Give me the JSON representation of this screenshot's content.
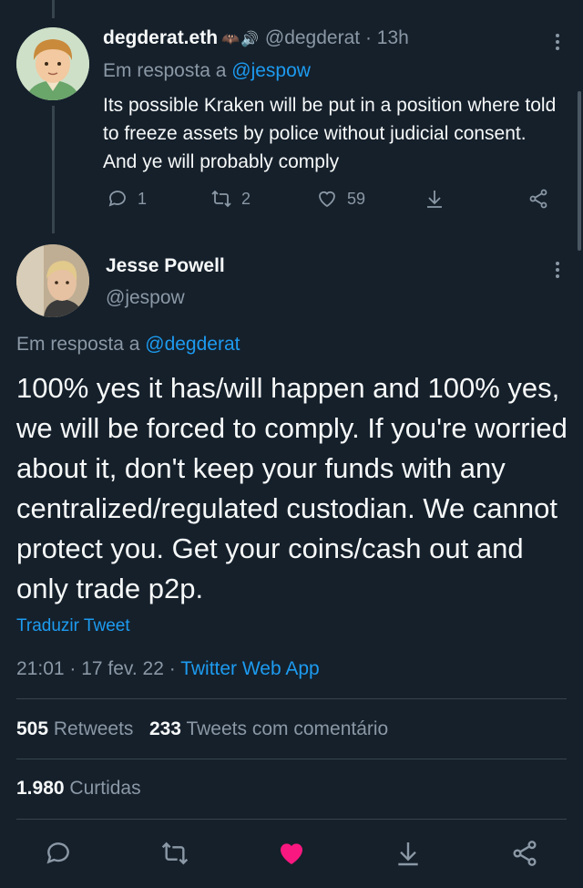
{
  "reply_tweet": {
    "display_name": "degderat.eth",
    "name_emoji": "🦇🔊",
    "handle": "@degderat",
    "time": "· 13h",
    "reply_prefix": "Em resposta a",
    "reply_to": "@jespow",
    "text": "Its possible Kraken will be put in a position where told to freeze assets by police without judicial consent. And ye will probably comply",
    "replies": "1",
    "retweets": "2",
    "likes": "59"
  },
  "main_tweet": {
    "display_name": "Jesse Powell",
    "handle": "@jespow",
    "reply_prefix": "Em resposta a",
    "reply_to": "@degderat",
    "text": "100% yes it has/will happen and 100% yes, we will be forced to comply. If you're worried about it, don't keep your funds with any centralized/regulated custodian. We cannot protect you. Get your coins/cash out and only trade p2p.",
    "translate": "Traduzir Tweet",
    "time": "21:01 · 17 fev. 22 ·",
    "source": "Twitter Web App",
    "retweet_count": "505",
    "retweet_label": "Retweets",
    "quote_count": "233",
    "quote_label": "Tweets com comentário",
    "like_count": "1.980",
    "like_label": "Curtidas"
  },
  "colors": {
    "background": "#15202b",
    "link": "#1d9bf0",
    "muted": "#8b98a5",
    "like": "#f91880"
  },
  "icons": [
    "more-icon",
    "reply-icon",
    "retweet-icon",
    "like-icon",
    "bookmark-icon",
    "share-icon"
  ]
}
